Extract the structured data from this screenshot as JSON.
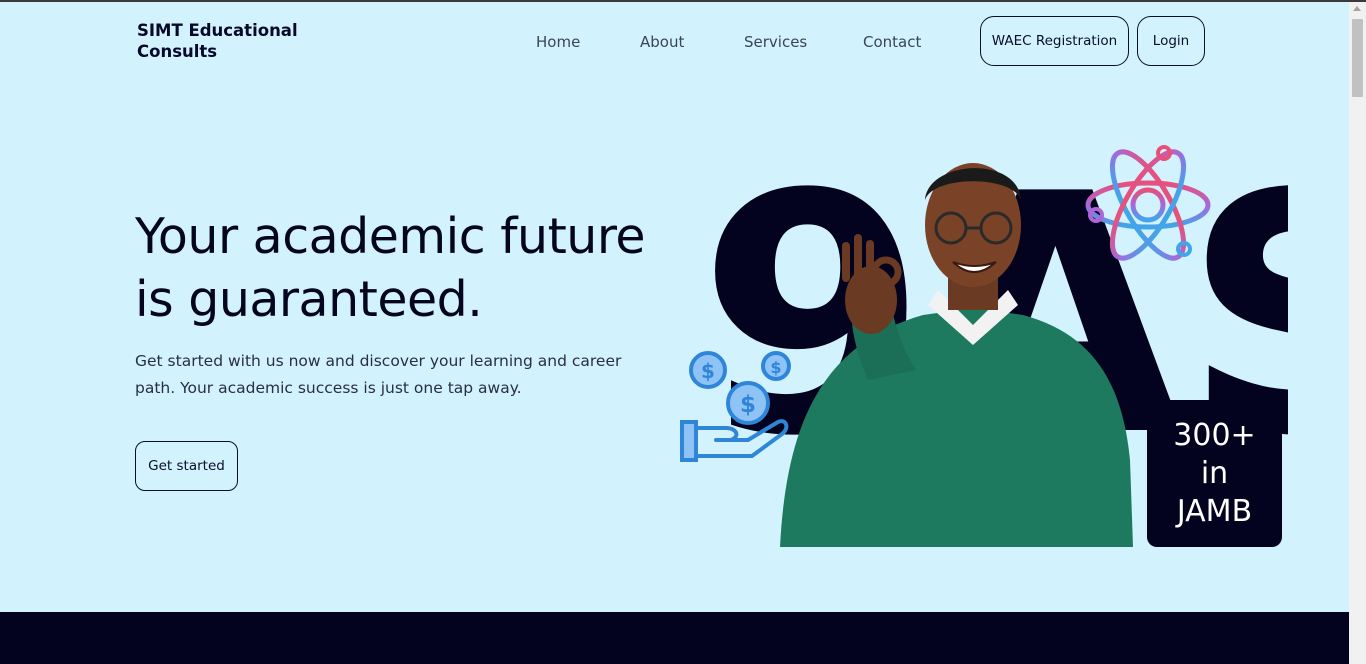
{
  "brand": {
    "name_line1": "SIMT Educational",
    "name_line2": "Consults"
  },
  "nav": {
    "items": [
      {
        "label": "Home"
      },
      {
        "label": "About"
      },
      {
        "label": "Services"
      },
      {
        "label": "Contact"
      }
    ],
    "waec_label": "WAEC Registration",
    "login_label": "Login"
  },
  "hero": {
    "title_line1": "Your academic future",
    "title_line2": "is guaranteed.",
    "subtitle_line1": "Get started with us now and discover your learning and career",
    "subtitle_line2": "path. Your academic success is just one tap away.",
    "cta_label": "Get started"
  },
  "art": {
    "big_text": "9AS",
    "badge_line1": "300+",
    "badge_line2": "in",
    "badge_line3": "JAMB"
  },
  "colors": {
    "background": "#d2f3fe",
    "navy": "#03021f",
    "sweater_green": "#1d7a5f",
    "coin_blue": "#3d8fe0"
  }
}
